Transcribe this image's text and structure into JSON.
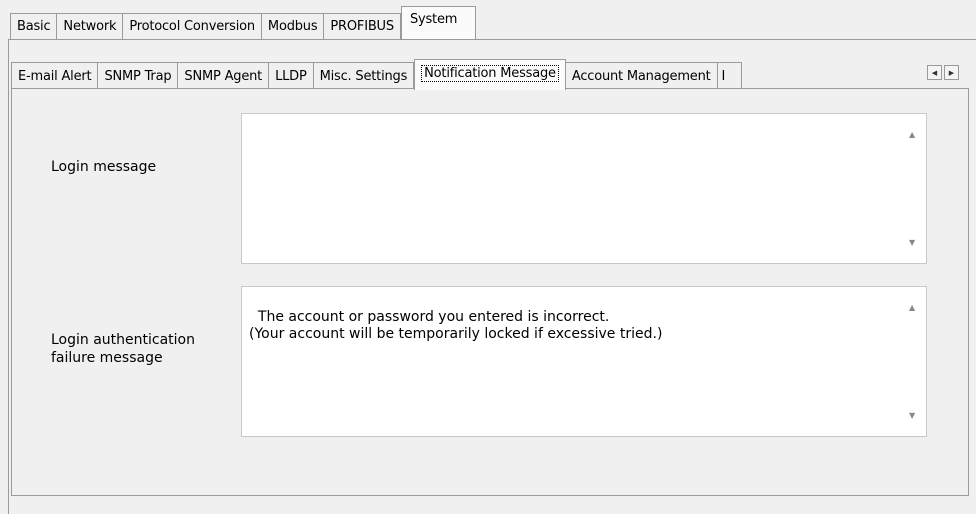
{
  "top_tabs": [
    "Basic",
    "Network",
    "Protocol Conversion",
    "Modbus",
    "PROFIBUS",
    "System"
  ],
  "sub_tabs": [
    "E-mail Alert",
    "SNMP Trap",
    "SNMP Agent",
    "LLDP",
    "Misc. Settings",
    "Notification Message",
    "Account Management",
    "I"
  ],
  "login_message": {
    "label": "Login message",
    "value": ""
  },
  "auth_failure_message": {
    "label_line1": "Login authentication",
    "label_line2": "failure message",
    "value": "The account or password you entered is incorrect.\n(Your account will be temporarily locked if excessive tried.)"
  }
}
